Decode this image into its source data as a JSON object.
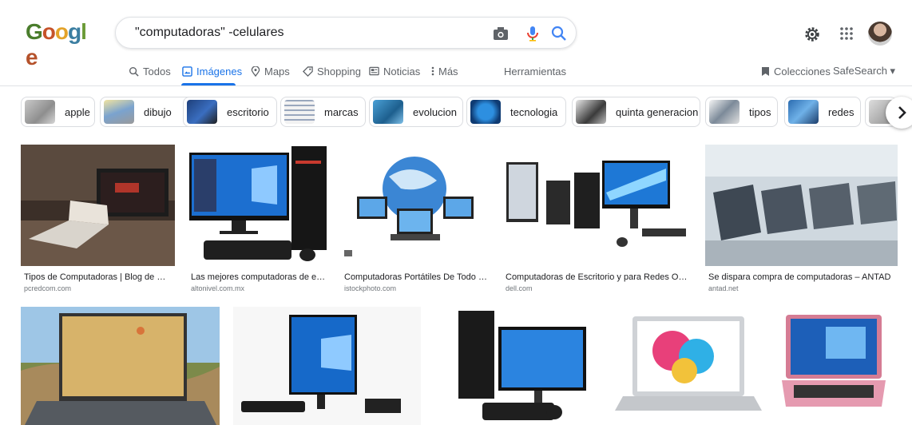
{
  "logo": {
    "letters": [
      "G",
      "o",
      "o",
      "g",
      "l",
      "e"
    ]
  },
  "search": {
    "query": "\"computadoras\" -celulares"
  },
  "nav": {
    "todos": "Todos",
    "imagenes": "Imágenes",
    "maps": "Maps",
    "shopping": "Shopping",
    "noticias": "Noticias",
    "mas": "Más",
    "herramientas": "Herramientas",
    "colecciones": "Colecciones",
    "safesearch": "SafeSearch ▾"
  },
  "chips": [
    "apple",
    "dibujo",
    "escritorio",
    "marcas",
    "evolucion",
    "tecnologia",
    "quinta generacion",
    "tipos",
    "redes"
  ],
  "results": [
    {
      "caption": "Tipos de Computadoras | Blog de Com...",
      "source": "pcredcom.com"
    },
    {
      "caption": "Las mejores computadoras de esc...",
      "source": "altonivel.com.mx"
    },
    {
      "caption": "Computadoras Portátiles De Todo El ...",
      "source": "istockphoto.com"
    },
    {
      "caption": "Computadoras de Escritorio y para Redes OptiPl...",
      "source": "dell.com"
    },
    {
      "caption": "Se dispara compra de computadoras – ANTAD",
      "source": "antad.net"
    }
  ],
  "colors": {
    "accent": "#1a73e8",
    "border": "#dfe1e5",
    "muted": "#5f6368"
  },
  "icons": [
    "camera-icon",
    "microphone-icon",
    "search-icon",
    "settings-gear-icon",
    "apps-grid-icon",
    "chevron-right-icon"
  ]
}
